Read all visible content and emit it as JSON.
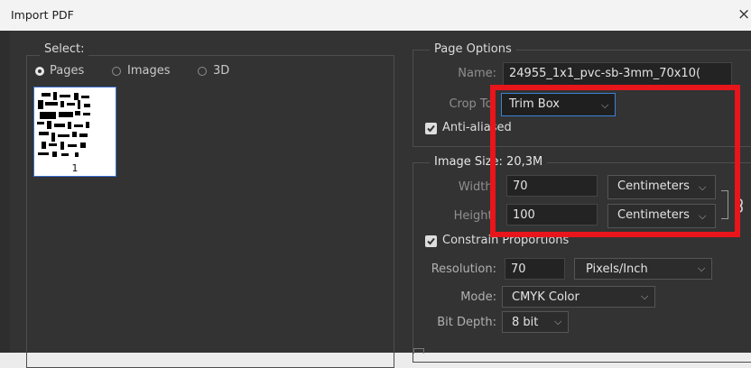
{
  "window": {
    "title": "Import PDF",
    "close_glyph": "×"
  },
  "select": {
    "label": "Select:",
    "options": [
      {
        "label": "Pages",
        "selected": true
      },
      {
        "label": "Images",
        "selected": false
      },
      {
        "label": "3D",
        "selected": false
      }
    ],
    "thumbnail": {
      "page_number": "1"
    }
  },
  "page_options": {
    "label": "Page Options",
    "name_label": "Name:",
    "name_value": "24955_1x1_pvc-sb-3mm_70x10(",
    "crop_to_label": "Crop To:",
    "crop_to_value": "Trim Box",
    "anti_aliased_label": "Anti-aliased",
    "anti_aliased_checked": true
  },
  "image_size": {
    "label": "Image Size: 20,3M",
    "width_label": "Width:",
    "width_value": "70",
    "width_unit": "Centimeters",
    "height_label": "Height:",
    "height_value": "100",
    "height_unit": "Centimeters",
    "constrain_label": "Constrain Proportions",
    "constrain_checked": true,
    "resolution_label": "Resolution:",
    "resolution_value": "70",
    "resolution_unit": "Pixels/Inch",
    "mode_label": "Mode:",
    "mode_value": "CMYK Color",
    "bit_depth_label": "Bit Depth:",
    "bit_depth_value": "8 bit"
  },
  "icons": [
    "close-icon",
    "chevron-down-icon",
    "link-icon",
    "checkmark-icon"
  ],
  "colors": {
    "highlight": "#e8151b",
    "focus": "#3b82d6",
    "panel": "#333333"
  }
}
